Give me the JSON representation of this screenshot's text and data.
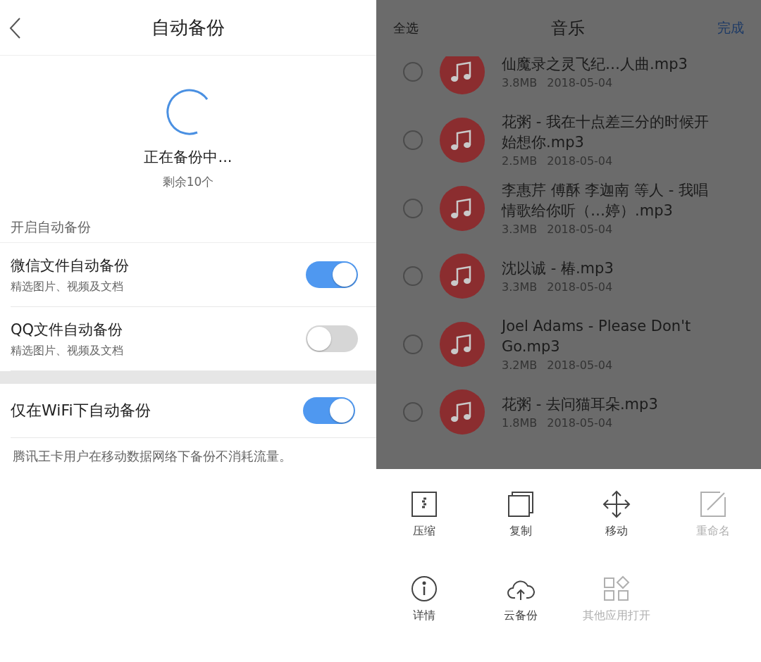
{
  "backup_screen": {
    "title": "自动备份",
    "status": "正在备份中...",
    "remaining": "剩余10个",
    "section_label": "开启自动备份",
    "settings": [
      {
        "title": "微信文件自动备份",
        "subtitle": "精选图片、视频及文档",
        "on": true
      },
      {
        "title": "QQ文件自动备份",
        "subtitle": "精选图片、视频及文档",
        "on": false
      }
    ],
    "wifi_setting": {
      "title": "仅在WiFi下自动备份",
      "on": true
    },
    "note": "腾讯王卡用户在移动数据网络下备份不消耗流量。"
  },
  "music_screen": {
    "select_all": "全选",
    "title": "音乐",
    "done": "完成",
    "files": [
      {
        "name": "仙魔录之灵飞纪…人曲.mp3",
        "size": "3.8MB",
        "date": "2018-05-04",
        "selected": false
      },
      {
        "name": "花粥 - 我在十点差三分的时候开始想你.mp3",
        "size": "2.5MB",
        "date": "2018-05-04",
        "selected": false
      },
      {
        "name": "李惠芹 傅酥 李迦南 等人 - 我唱情歌给你听（…婷）.mp3",
        "size": "3.3MB",
        "date": "2018-05-04",
        "selected": false
      },
      {
        "name": "沈以诚 - 椿.mp3",
        "size": "3.3MB",
        "date": "2018-05-04",
        "selected": false
      },
      {
        "name": "Joel Adams - Please Don't Go.mp3",
        "size": "3.2MB",
        "date": "2018-05-04",
        "selected": false
      },
      {
        "name": "花粥 - 去问猫耳朵.mp3",
        "size": "1.8MB",
        "date": "2018-05-04",
        "selected": false
      }
    ],
    "actions": [
      {
        "label": "压缩",
        "disabled": false
      },
      {
        "label": "复制",
        "disabled": false
      },
      {
        "label": "移动",
        "disabled": false
      },
      {
        "label": "重命名",
        "disabled": true
      },
      {
        "label": "详情",
        "disabled": false
      },
      {
        "label": "云备份",
        "disabled": false
      },
      {
        "label": "其他应用打开",
        "disabled": true
      }
    ]
  }
}
